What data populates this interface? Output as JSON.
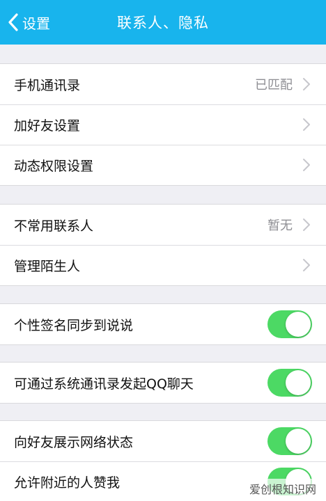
{
  "colors": {
    "nav_bg": "#18b4ed",
    "toggle_on": "#4cd964",
    "page_bg": "#efeff4"
  },
  "navbar": {
    "back_label": "设置",
    "title": "联系人、隐私"
  },
  "group1": {
    "items": [
      {
        "label": "手机通讯录",
        "value": "已匹配",
        "icon": "chevron-right-icon"
      },
      {
        "label": "加好友设置",
        "icon": "chevron-right-icon"
      },
      {
        "label": "动态权限设置",
        "icon": "chevron-right-icon"
      }
    ]
  },
  "group2": {
    "items": [
      {
        "label": "不常用联系人",
        "value": "暂无",
        "icon": "chevron-right-icon"
      },
      {
        "label": "管理陌生人",
        "icon": "chevron-right-icon"
      }
    ]
  },
  "group3": {
    "items": [
      {
        "label": "个性签名同步到说说",
        "toggle_on": true
      }
    ]
  },
  "group4": {
    "items": [
      {
        "label": "可通过系统通讯录发起QQ聊天",
        "toggle_on": true
      }
    ]
  },
  "group5": {
    "items": [
      {
        "label": "向好友展示网络状态",
        "toggle_on": true
      },
      {
        "label": "允许附近的人赞我",
        "toggle_on": true
      }
    ]
  },
  "watermark": "爱创根知识网"
}
